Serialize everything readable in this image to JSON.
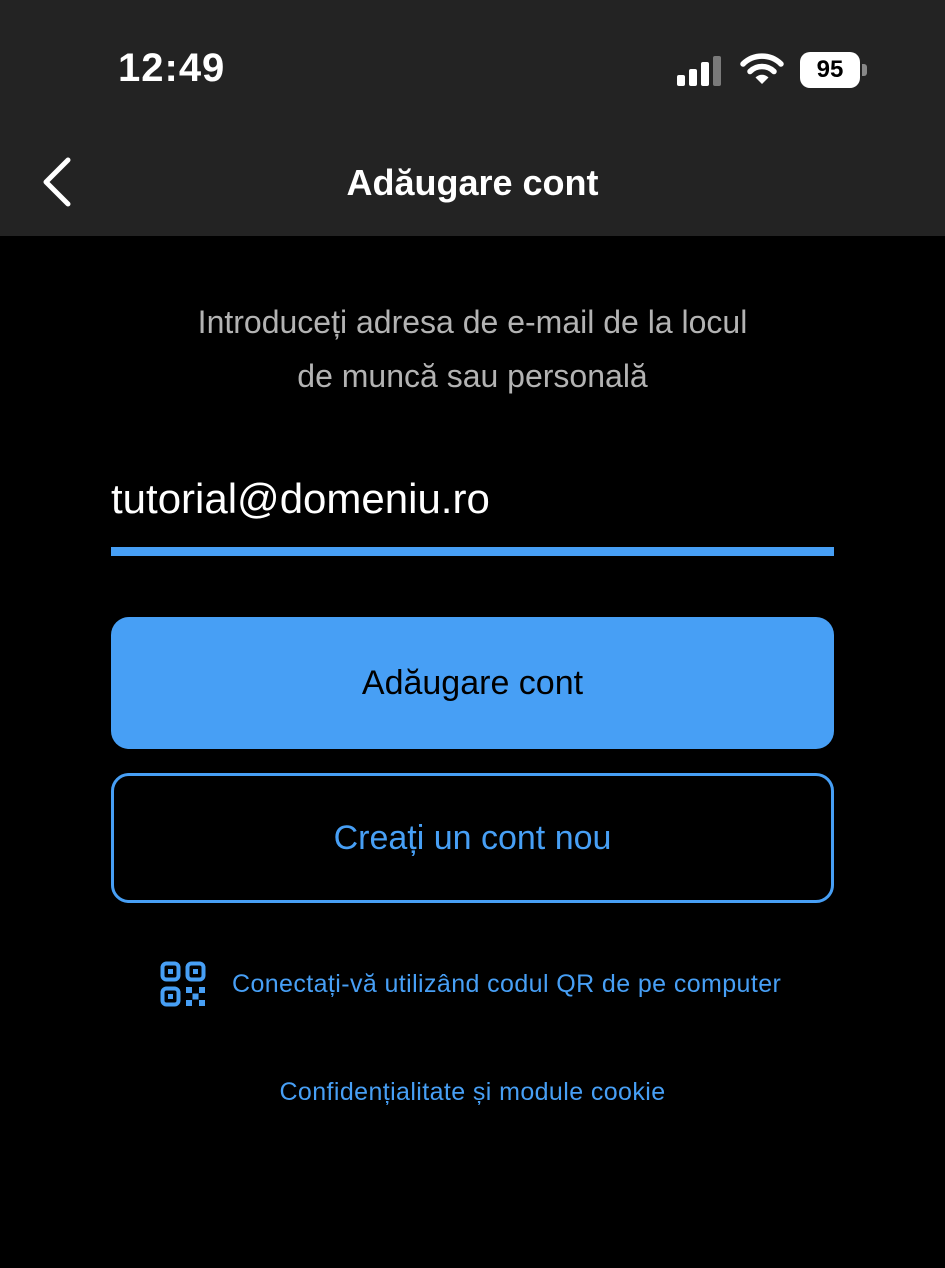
{
  "status_bar": {
    "time": "12:49",
    "battery_level": "95",
    "icons": [
      "signal-icon",
      "wifi-icon",
      "battery-icon"
    ]
  },
  "nav": {
    "title": "Adăugare cont",
    "back_icon": "chevron-left-icon"
  },
  "instruction": {
    "line1": "Introduceți adresa de e-mail de la locul",
    "line2": "de muncă sau personală"
  },
  "email": {
    "value": "tutorial@domeniu.ro"
  },
  "buttons": {
    "add_account": "Adăugare cont",
    "create_account": "Creați un cont nou"
  },
  "qr": {
    "icon": "qr-code-icon",
    "label": "Conectați-vă utilizând codul QR de pe computer"
  },
  "privacy": {
    "label": "Confidențialitate și module cookie"
  },
  "colors": {
    "accent": "#479ff5",
    "bar_background": "#232323",
    "background": "#000000",
    "instruction_text": "#b3b3b3"
  }
}
